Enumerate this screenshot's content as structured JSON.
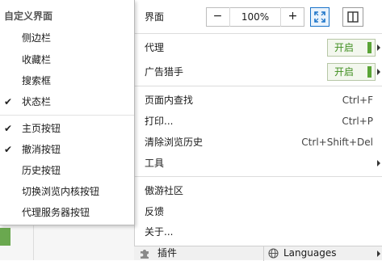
{
  "submenu": {
    "header": "自定义界面",
    "items": [
      {
        "label": "侧边栏",
        "checked": false
      },
      {
        "label": "收藏栏",
        "checked": false
      },
      {
        "label": "搜索框",
        "checked": false
      },
      {
        "label": "状态栏",
        "checked": true
      },
      {
        "label": "主页按钮",
        "checked": true
      },
      {
        "label": "撤消按钮",
        "checked": true
      },
      {
        "label": "历史按钮",
        "checked": false
      },
      {
        "label": "切换浏览内核按钮",
        "checked": false
      },
      {
        "label": "代理服务器按钮",
        "checked": false
      }
    ],
    "check_glyph": "✔"
  },
  "mainmenu": {
    "zoom": {
      "label": "界面",
      "minus": "−",
      "value": "100%",
      "plus": "+"
    },
    "proxy": {
      "label": "代理",
      "toggle": "开启"
    },
    "adblock": {
      "label": "广告猎手",
      "toggle": "开启"
    },
    "find": {
      "label": "页面内查找",
      "shortcut": "Ctrl+F"
    },
    "print": {
      "label": "打印...",
      "shortcut": "Ctrl+P"
    },
    "clear": {
      "label": "清除浏览历史",
      "shortcut": "Ctrl+Shift+Del"
    },
    "tools": {
      "label": "工具"
    },
    "community": {
      "label": "傲游社区"
    },
    "feedback": {
      "label": "反馈"
    },
    "about": {
      "label": "关于..."
    }
  },
  "bottom_bar": {
    "plugins": "插件",
    "languages": "Languages"
  },
  "colors": {
    "accent_blue": "#1a73c8",
    "toggle_green": "#5aa436"
  }
}
